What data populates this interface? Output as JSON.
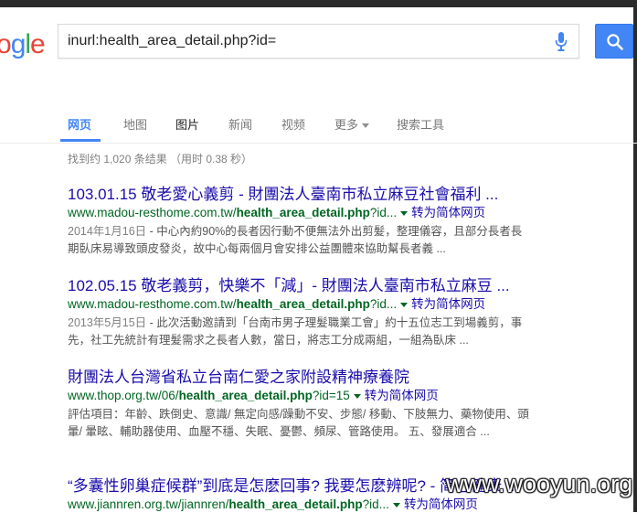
{
  "logo": {
    "letters": [
      "o",
      "g",
      "l",
      "e"
    ],
    "colors": [
      "#ea4335",
      "#4285f4",
      "#34a853",
      "#ea4335"
    ]
  },
  "search": {
    "query": "inurl:health_area_detail.php?id="
  },
  "tabs": [
    {
      "label": "网页"
    },
    {
      "label": "地图"
    },
    {
      "label": "图片"
    },
    {
      "label": "新闻"
    },
    {
      "label": "视频"
    },
    {
      "label": "更多"
    },
    {
      "label": "搜索工具"
    }
  ],
  "stats": "找到约 1,020 条结果 （用时 0.38 秒）",
  "results": [
    {
      "title": "103.01.15 敬老愛心義剪 - 財團法人臺南市私立麻豆社會福利 ...",
      "url_pre": "www.madou-resthome.com.tw/",
      "url_bold": "health_area_detail.php",
      "url_post": "?id...",
      "translate": "转为简体网页",
      "date": "2014年1月16日",
      "snippet": " - 中心內約90%的長者因行動不便無法外出剪髮，整理儀容，且部分長者長期臥床易導致頭皮發炎，故中心每兩個月會安排公益團體來協助幫長者義 ..."
    },
    {
      "title": "102.05.15 敬老義剪，快樂不「減」- 財團法人臺南市私立麻豆 ...",
      "url_pre": "www.madou-resthome.com.tw/",
      "url_bold": "health_area_detail.php",
      "url_post": "?id...",
      "translate": "转为简体网页",
      "date": "2013年5月15日",
      "snippet": " - 此次活動邀請到「台南市男子理髮職業工會」約十五位志工到場義剪，事先，社工先統計有理髮需求之長者人數，當日，將志工分成兩組，一組為臥床 ..."
    },
    {
      "title": "財團法人台灣省私立台南仁愛之家附設精神療養院",
      "url_pre": "www.thop.org.tw/06/",
      "url_bold": "health_area_detail.php",
      "url_post": "?id=15",
      "translate": "转为简体网页",
      "date": "",
      "snippet": "評估項目：年齡、跌倒史、意識/ 無定向感/躁動不安、步態/ 移動、下肢無力、藥物使用、頭暈/ 暈眩、輔助器使用、血壓不穩、失眠、憂鬱、頻尿、管路使用。 五、發展適合 ..."
    },
    {
      "title": "“多囊性卵巢症候群”到底是怎麽回事? 我要怎麽辨呢? - 简心健康 ...",
      "url_pre": "www.jiannren.org.tw/jiannren/",
      "url_bold": "health_area_detail.php",
      "url_post": "?id...",
      "translate": "转为简体网页",
      "date": "",
      "snippet": ""
    }
  ],
  "watermark": "www.wooyun.org"
}
